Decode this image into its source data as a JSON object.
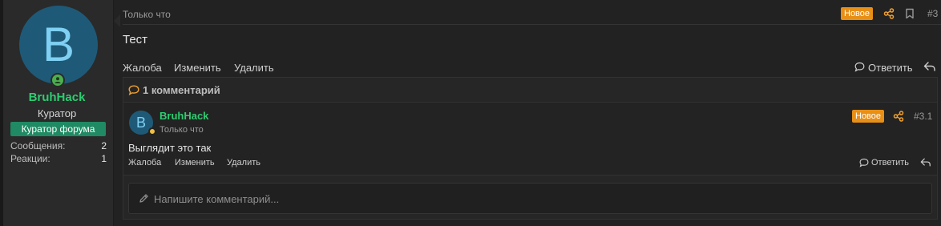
{
  "user": {
    "avatar_letter": "B",
    "username": "BruhHack",
    "title": "Куратор",
    "banner": "Куратор форума",
    "stats": [
      {
        "label": "Сообщения:",
        "value": "2"
      },
      {
        "label": "Реакции:",
        "value": "1"
      }
    ]
  },
  "post": {
    "time": "Только что",
    "badge": "Новое",
    "number": "#3",
    "text": "Тест",
    "actions": {
      "report": "Жалоба",
      "edit": "Изменить",
      "delete": "Удалить",
      "reply": "Ответить"
    }
  },
  "comments": {
    "header": "1 комментарий",
    "items": [
      {
        "avatar_letter": "B",
        "author": "BruhHack",
        "time": "Только что",
        "badge": "Новое",
        "number": "#3.1",
        "text": "Выглядит это так",
        "actions": {
          "report": "Жалоба",
          "edit": "Изменить",
          "delete": "Удалить",
          "reply": "Ответить"
        }
      }
    ],
    "input_placeholder": "Напишите комментарий..."
  },
  "colors": {
    "accent": "#2ecc71",
    "badge": "#e88f16",
    "banner": "#1f8a63",
    "avatar_bg": "#1e5a78",
    "icon_orange": "#f0a030"
  }
}
